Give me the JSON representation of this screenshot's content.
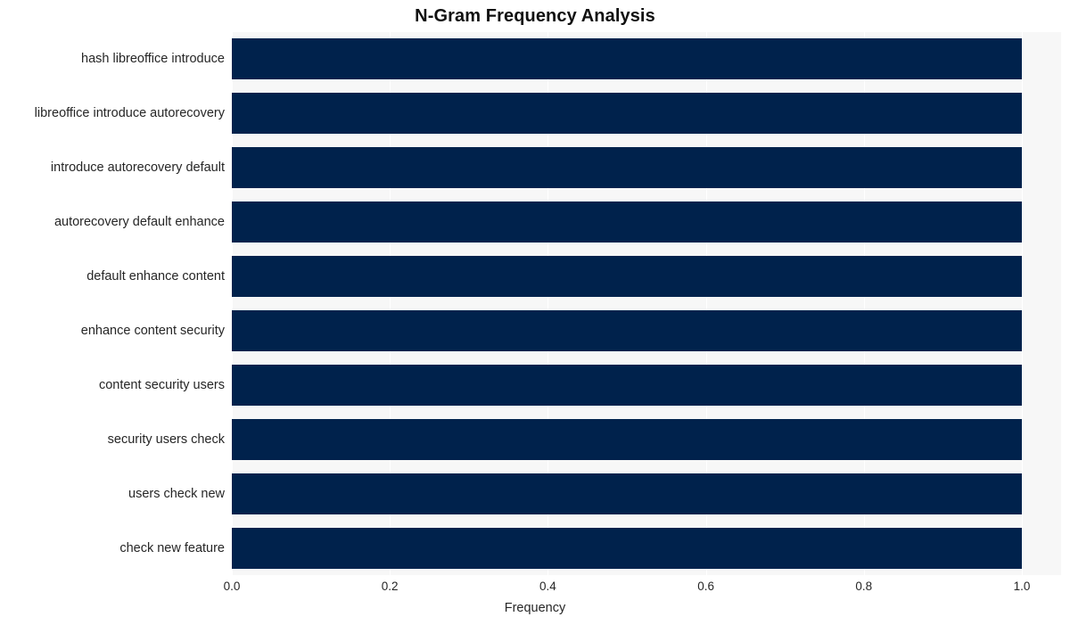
{
  "chart_data": {
    "type": "bar",
    "orientation": "horizontal",
    "title": "N-Gram Frequency Analysis",
    "xlabel": "Frequency",
    "ylabel": "",
    "xlim": [
      0.0,
      1.0
    ],
    "xticks": [
      "0.0",
      "0.2",
      "0.4",
      "0.6",
      "0.8",
      "1.0"
    ],
    "xtick_values": [
      0.0,
      0.2,
      0.4,
      0.6,
      0.8,
      1.0
    ],
    "grid": true,
    "grid_axis": "x",
    "legend": false,
    "bar_color": "#00224c",
    "plot_background": "#f7f7f7",
    "figure_background": "#ffffff",
    "categories": [
      "hash libreoffice introduce",
      "libreoffice introduce autorecovery",
      "introduce autorecovery default",
      "autorecovery default enhance",
      "default enhance content",
      "enhance content security",
      "content security users",
      "security users check",
      "users check new",
      "check new feature"
    ],
    "values": [
      1.0,
      1.0,
      1.0,
      1.0,
      1.0,
      1.0,
      1.0,
      1.0,
      1.0,
      1.0
    ]
  }
}
